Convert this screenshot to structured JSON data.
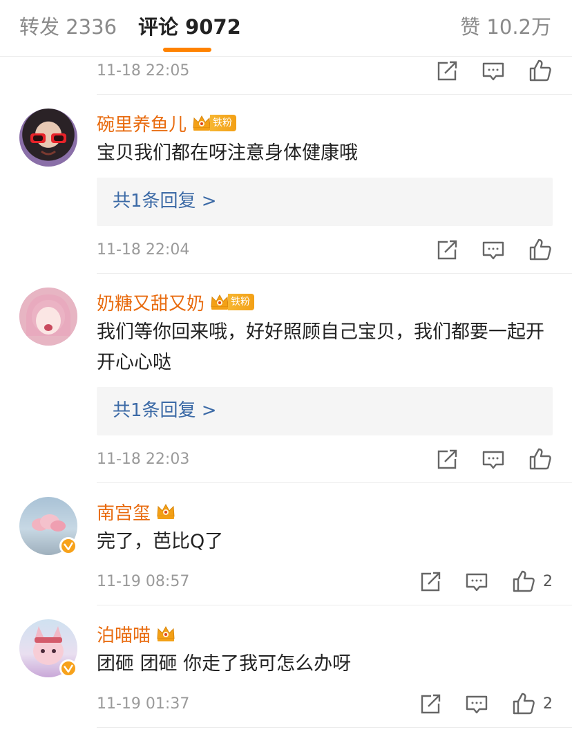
{
  "header": {
    "repost_label": "转发 2336",
    "comment_label": "评论 9072",
    "like_label": "赞 10.2万"
  },
  "top_item": {
    "time": "11-18 22:05"
  },
  "comments": [
    {
      "username": "碗里养鱼儿",
      "fan_badge": "铁粉",
      "text": "宝贝我们都在呀注意身体健康哦",
      "replies": "共1条回复 >",
      "time": "11-18 22:04"
    },
    {
      "username": "奶糖又甜又奶",
      "fan_badge": "铁粉",
      "text": "我们等你回来哦，好好照顾自己宝贝，我们都要一起开开心心哒",
      "replies": "共1条回复 >",
      "time": "11-18 22:03"
    },
    {
      "username": "南宫玺",
      "text": "完了，芭比Q了",
      "time": "11-19 08:57",
      "likes": "2"
    },
    {
      "username": "泊喵喵",
      "text": "团砸 团砸 你走了我可怎么办呀",
      "time": "11-19 01:37",
      "likes": "2"
    }
  ],
  "colors": {
    "accent": "#ff8200",
    "username": "#e86b0f",
    "link": "#3c6aa6",
    "verified": "#f7a21b"
  }
}
